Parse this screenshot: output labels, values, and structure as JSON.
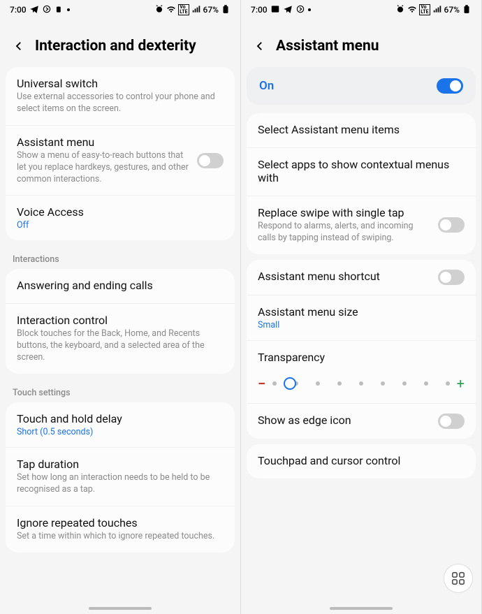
{
  "status": {
    "time": "7:00",
    "battery": "67%",
    "net_label": "Vo LTE"
  },
  "left": {
    "title": "Interaction and dexterity",
    "items": {
      "universal": {
        "title": "Universal switch",
        "desc": "Use external accessories to control your phone and select items on the screen."
      },
      "assistant": {
        "title": "Assistant menu",
        "desc": "Show a menu of easy-to-reach buttons that let you replace hardkeys, gestures, and other common interactions."
      },
      "voice": {
        "title": "Voice Access",
        "value": "Off"
      }
    },
    "section_interactions": "Interactions",
    "interactions": {
      "answer": {
        "title": "Answering and ending calls"
      },
      "control": {
        "title": "Interaction control",
        "desc": "Block touches for the Back, Home, and Recents buttons, the keyboard, and a selected area of the screen."
      }
    },
    "section_touch": "Touch settings",
    "touch": {
      "hold": {
        "title": "Touch and hold delay",
        "value": "Short (0.5 seconds)"
      },
      "tap": {
        "title": "Tap duration",
        "desc": "Set how long an interaction needs to be held to be recognised as a tap."
      },
      "ignore": {
        "title": "Ignore repeated touches",
        "desc": "Set a time within which to ignore repeated touches."
      }
    }
  },
  "right": {
    "title": "Assistant menu",
    "on_label": "On",
    "items": {
      "select_items": {
        "title": "Select Assistant menu items"
      },
      "select_apps": {
        "title": "Select apps to show contextual menus with"
      },
      "replace_swipe": {
        "title": "Replace swipe with single tap",
        "desc": "Respond to alarms, alerts, and incoming calls by tapping instead of swiping."
      },
      "shortcut": {
        "title": "Assistant menu shortcut"
      },
      "size": {
        "title": "Assistant menu size",
        "value": "Small"
      },
      "transparency": {
        "title": "Transparency"
      },
      "edge": {
        "title": "Show as edge icon"
      },
      "touchpad": {
        "title": "Touchpad and cursor control"
      }
    }
  }
}
